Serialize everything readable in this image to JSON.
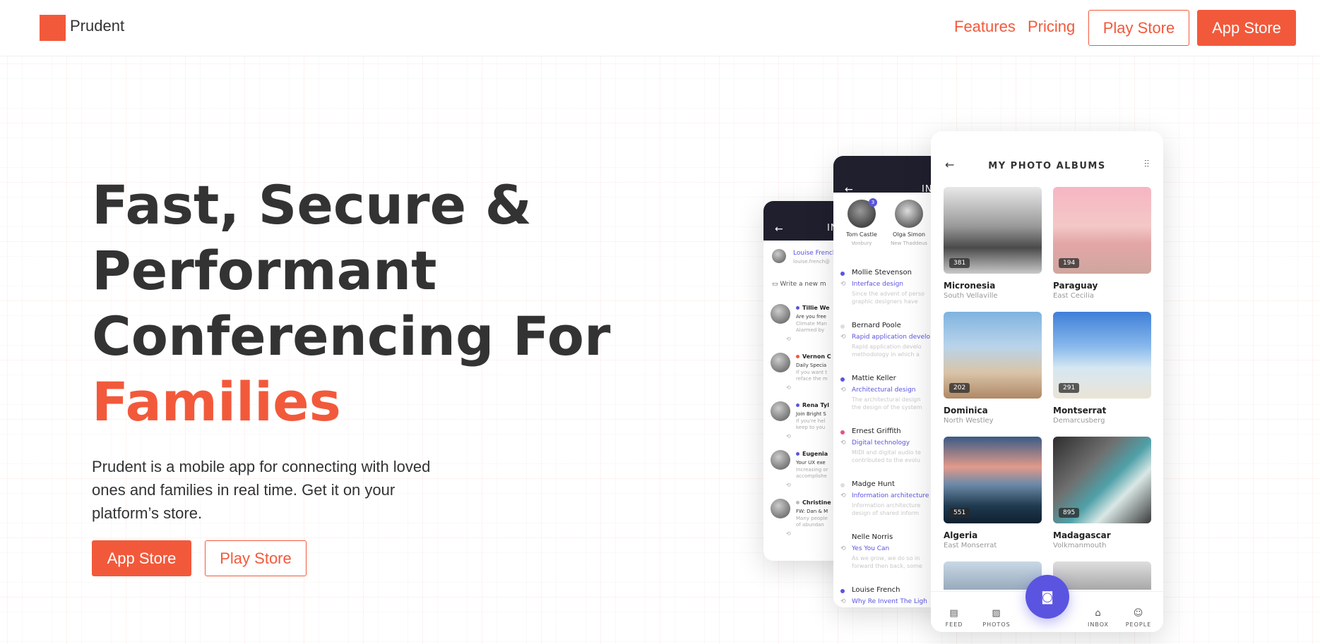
{
  "nav": {
    "brand": "Prudent",
    "links": [
      "Features",
      "Pricing"
    ],
    "play_store": "Play Store",
    "app_store": "App Store"
  },
  "hero": {
    "title_line1": "Fast, Secure &",
    "title_line2": "Performant",
    "title_line3": "Conferencing For",
    "title_accent": "Families",
    "description": "Prudent is a mobile app for connecting with loved ones and families in real time. Get it on your platform’s store.",
    "cta_app_store": "App Store",
    "cta_play_store": "Play Store"
  },
  "colors": {
    "accent": "#f2593b",
    "phone_purple": "#5a54e0",
    "dark_bar": "#1f1f2e"
  },
  "phone_inbox_left": {
    "title": "IN",
    "contact_name": "Louise French",
    "contact_email": "louise.french@",
    "compose_placeholder": "Write a new m",
    "messages": [
      {
        "name": "Tillie We",
        "line1": "Are you free",
        "line2": "Climate Man",
        "line3": "Alarmed by"
      },
      {
        "name": "Vernon C",
        "line1": "Daily Specia",
        "line2": "If you want t",
        "line3": "reface the m"
      },
      {
        "name": "Rena Tyl",
        "line1": "Join Bright S",
        "line2": "If you're hel",
        "line3": "keep to you"
      },
      {
        "name": "Eugenia",
        "line1": "Your UX exe",
        "line2": "Increasing or",
        "line3": "accomplishe"
      },
      {
        "name": "Christine",
        "line1": "FW: Dan & M",
        "line2": "Many people",
        "line3": "of abundan"
      }
    ]
  },
  "phone_inbox_middle": {
    "title": "IN",
    "contacts": [
      {
        "name": "Tom Castle",
        "place": "Vonbury",
        "badge": "3"
      },
      {
        "name": "Olga Simon",
        "place": "New Thaddeus"
      }
    ],
    "messages": [
      {
        "name": "Mollie Stevenson",
        "subject": "Interface design",
        "preview1": "Since the advent of perso",
        "preview2": "graphic designers have"
      },
      {
        "name": "Bernard Poole",
        "subject": "Rapid application develo",
        "preview1": "Rapid application develo",
        "preview2": "methodology in which a"
      },
      {
        "name": "Mattie Keller",
        "subject": "Architectural design",
        "preview1": "The architectural design",
        "preview2": "the design of the system"
      },
      {
        "name": "Ernest Griffith",
        "subject": "Digital technology",
        "preview1": "MIDI and digital audio te",
        "preview2": "contributed to the evolu"
      },
      {
        "name": "Madge Hunt",
        "subject": "Information architecture",
        "preview1": "Information architecture",
        "preview2": "design of shared inform"
      },
      {
        "name": "Nelle Norris",
        "subject": "Yes You Can",
        "preview1": "As we grow, we do so in",
        "preview2": "forward then back, some"
      },
      {
        "name": "Louise French",
        "subject": "Why Re Invent The Ligh",
        "preview1": "",
        "preview2": ""
      }
    ]
  },
  "phone_albums": {
    "title": "MY PHOTO ALBUMS",
    "albums": [
      {
        "name": "Micronesia",
        "sub": "South Vellaville",
        "count": "381"
      },
      {
        "name": "Paraguay",
        "sub": "East Cecilia",
        "count": "194"
      },
      {
        "name": "Dominica",
        "sub": "North Westley",
        "count": "202"
      },
      {
        "name": "Montserrat",
        "sub": "Demarcusberg",
        "count": "291"
      },
      {
        "name": "Algeria",
        "sub": "East Monserrat",
        "count": "551"
      },
      {
        "name": "Madagascar",
        "sub": "Volkmanmouth",
        "count": "895"
      }
    ],
    "tabs": [
      "FEED",
      "PHOTOS",
      "INBOX",
      "PEOPLE"
    ]
  }
}
